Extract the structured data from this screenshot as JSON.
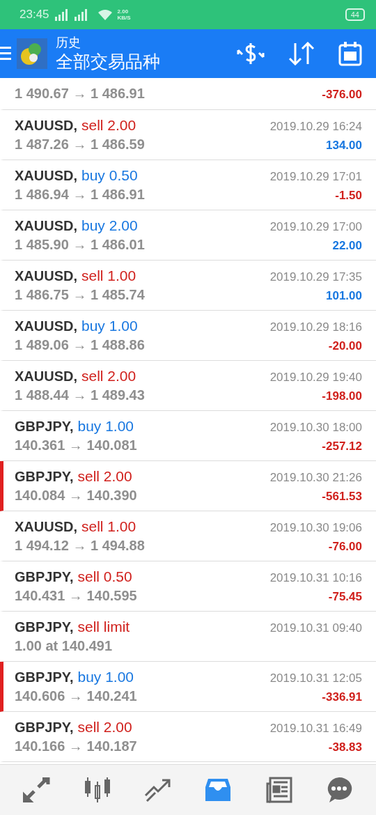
{
  "status_bar": {
    "time": "23:45",
    "speed": "2.00",
    "speed_unit": "KB/S",
    "battery": "44"
  },
  "header": {
    "title": "历史",
    "subtitle": "全部交易品种"
  },
  "rows": [
    {
      "kind": "partial",
      "prices": "1 490.67 → 1 486.91",
      "profit": "-376.00",
      "profit_positive": false,
      "flagged": false
    },
    {
      "kind": "deal",
      "symbol": "XAUUSD,",
      "is_buy": false,
      "action": "sell 2.00",
      "time": "2019.10.29 16:24",
      "prices": "1 487.26 → 1 486.59",
      "profit": "134.00",
      "profit_positive": true,
      "flagged": false
    },
    {
      "kind": "deal",
      "symbol": "XAUUSD,",
      "is_buy": true,
      "action": "buy 0.50",
      "time": "2019.10.29 17:01",
      "prices": "1 486.94 → 1 486.91",
      "profit": "-1.50",
      "profit_positive": false,
      "flagged": false
    },
    {
      "kind": "deal",
      "symbol": "XAUUSD,",
      "is_buy": true,
      "action": "buy 2.00",
      "time": "2019.10.29 17:00",
      "prices": "1 485.90 → 1 486.01",
      "profit": "22.00",
      "profit_positive": true,
      "flagged": false
    },
    {
      "kind": "deal",
      "symbol": "XAUUSD,",
      "is_buy": false,
      "action": "sell 1.00",
      "time": "2019.10.29 17:35",
      "prices": "1 486.75 → 1 485.74",
      "profit": "101.00",
      "profit_positive": true,
      "flagged": false
    },
    {
      "kind": "deal",
      "symbol": "XAUUSD,",
      "is_buy": true,
      "action": "buy 1.00",
      "time": "2019.10.29 18:16",
      "prices": "1 489.06 → 1 488.86",
      "profit": "-20.00",
      "profit_positive": false,
      "flagged": false
    },
    {
      "kind": "deal",
      "symbol": "XAUUSD,",
      "is_buy": false,
      "action": "sell 2.00",
      "time": "2019.10.29 19:40",
      "prices": "1 488.44 → 1 489.43",
      "profit": "-198.00",
      "profit_positive": false,
      "flagged": false
    },
    {
      "kind": "deal",
      "symbol": "GBPJPY,",
      "is_buy": true,
      "action": "buy 1.00",
      "time": "2019.10.30 18:00",
      "prices": "140.361 → 140.081",
      "profit": "-257.12",
      "profit_positive": false,
      "flagged": false
    },
    {
      "kind": "deal",
      "symbol": "GBPJPY,",
      "is_buy": false,
      "action": "sell 2.00",
      "time": "2019.10.30 21:26",
      "prices": "140.084 → 140.390",
      "profit": "-561.53",
      "profit_positive": false,
      "flagged": true
    },
    {
      "kind": "deal",
      "symbol": "XAUUSD,",
      "is_buy": false,
      "action": "sell 1.00",
      "time": "2019.10.30 19:06",
      "prices": "1 494.12 → 1 494.88",
      "profit": "-76.00",
      "profit_positive": false,
      "flagged": false
    },
    {
      "kind": "deal",
      "symbol": "GBPJPY,",
      "is_buy": false,
      "action": "sell 0.50",
      "time": "2019.10.31 10:16",
      "prices": "140.431 → 140.595",
      "profit": "-75.45",
      "profit_positive": false,
      "flagged": false
    },
    {
      "kind": "order",
      "symbol": "GBPJPY,",
      "is_buy": false,
      "action": "sell limit",
      "time": "2019.10.31 09:40",
      "prices": "1.00 at 140.491",
      "flagged": false
    },
    {
      "kind": "deal",
      "symbol": "GBPJPY,",
      "is_buy": true,
      "action": "buy 1.00",
      "time": "2019.10.31 12:05",
      "prices": "140.606 → 140.241",
      "profit": "-336.91",
      "profit_positive": false,
      "flagged": true
    },
    {
      "kind": "deal",
      "symbol": "GBPJPY,",
      "is_buy": false,
      "action": "sell 2.00",
      "time": "2019.10.31 16:49",
      "prices": "140.166 → 140.187",
      "profit": "-38.83",
      "profit_positive": false,
      "flagged": false
    }
  ],
  "nav": [
    {
      "kind": "quotes",
      "selected": false
    },
    {
      "kind": "chart",
      "selected": false
    },
    {
      "kind": "trade",
      "selected": false
    },
    {
      "kind": "history",
      "selected": true
    },
    {
      "kind": "news",
      "selected": false
    },
    {
      "kind": "chat",
      "selected": false
    }
  ]
}
